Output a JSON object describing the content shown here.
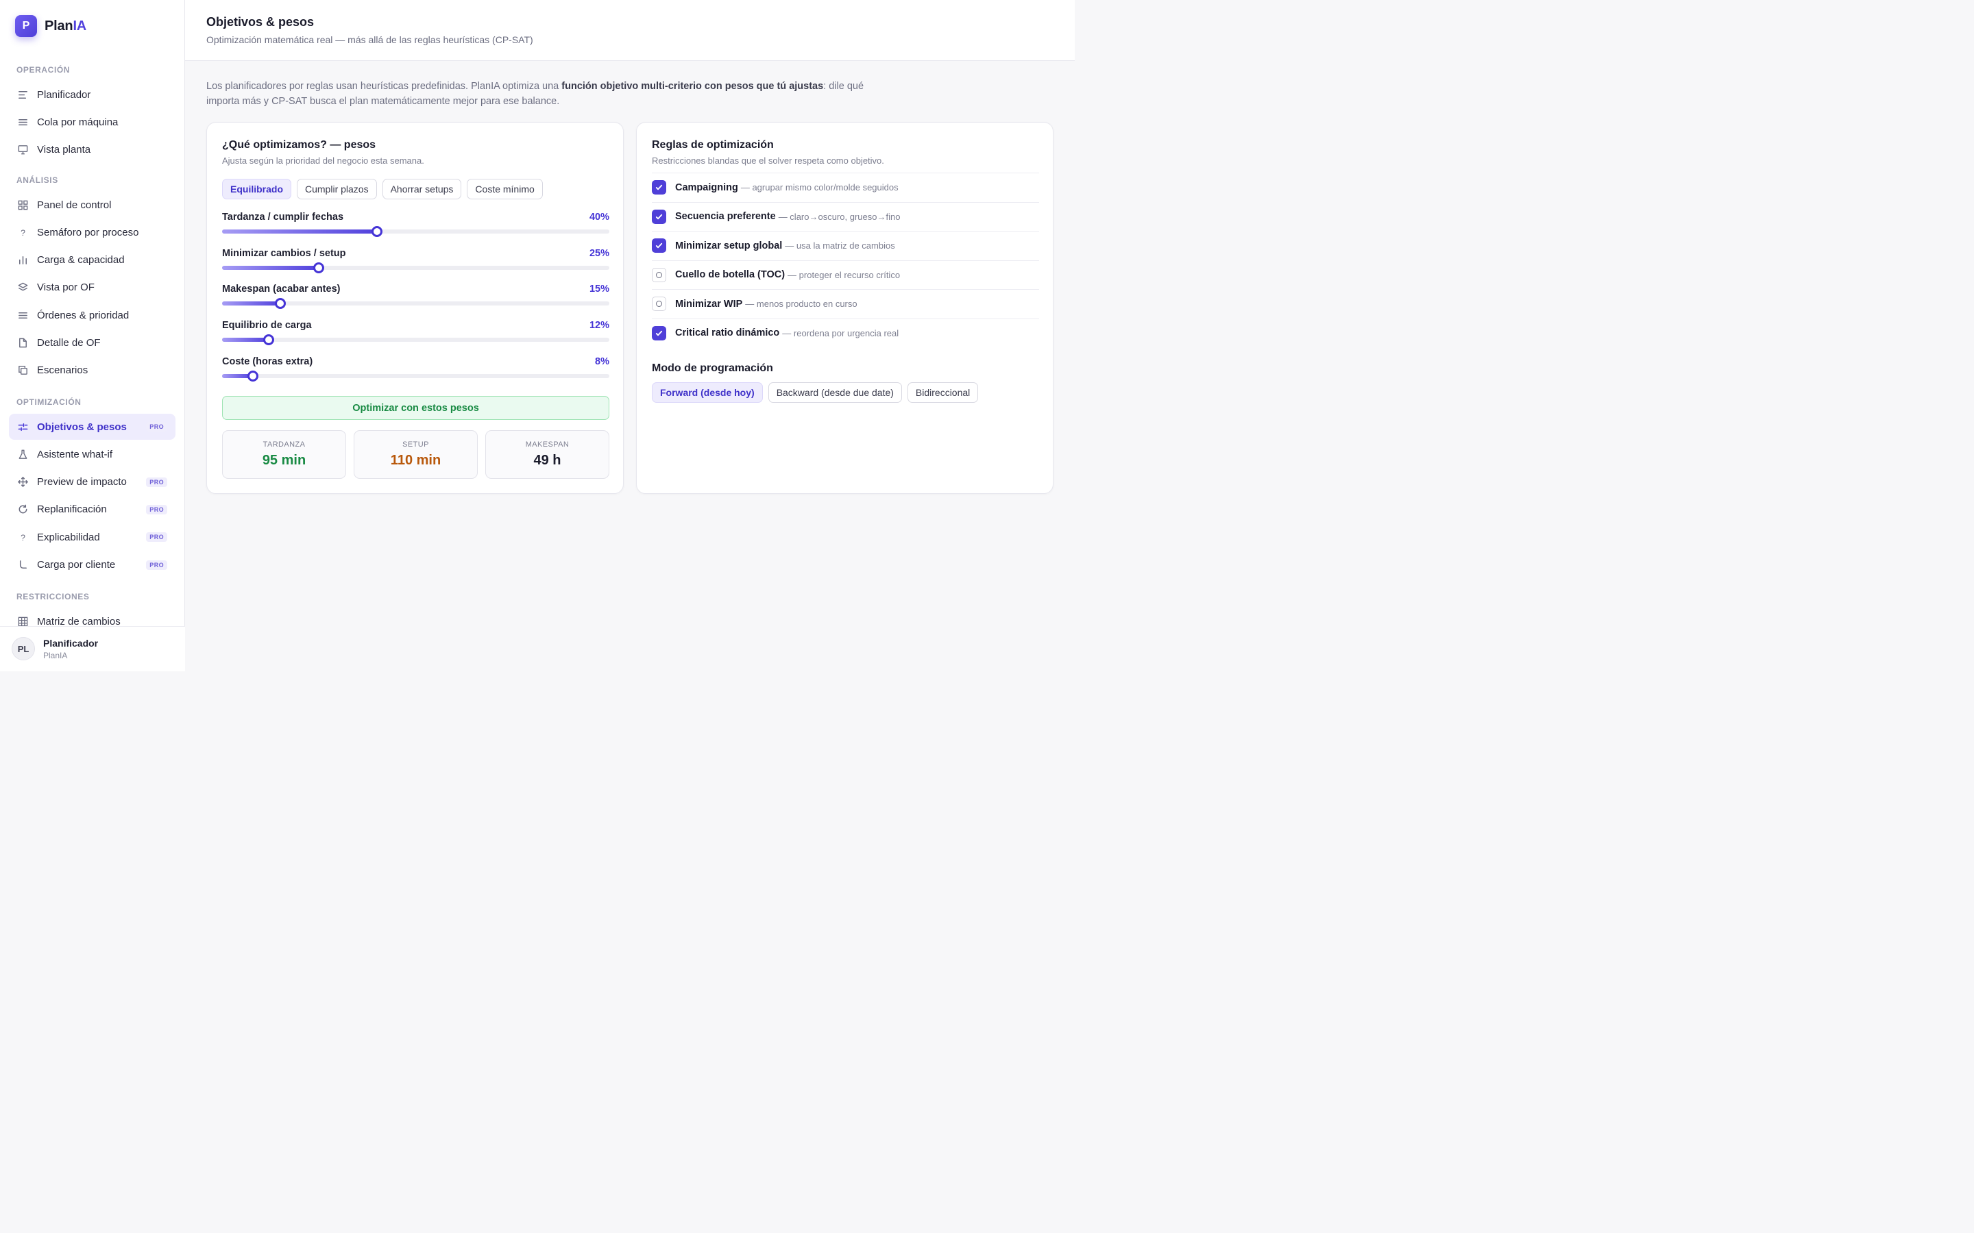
{
  "app": {
    "logo_letter": "P",
    "name_plain": "Plan",
    "name_accent": "IA"
  },
  "sidebar": {
    "sections": [
      {
        "label": "OPERACIÓN",
        "items": [
          {
            "label": "Planificador",
            "icon": "align-left-icon"
          },
          {
            "label": "Cola por máquina",
            "icon": "list-icon"
          },
          {
            "label": "Vista planta",
            "icon": "monitor-icon"
          }
        ]
      },
      {
        "label": "ANÁLISIS",
        "items": [
          {
            "label": "Panel de control",
            "icon": "grid-icon"
          },
          {
            "label": "Semáforo por proceso",
            "icon": "question-icon"
          },
          {
            "label": "Carga & capacidad",
            "icon": "bar-chart-icon"
          },
          {
            "label": "Vista por OF",
            "icon": "layers-icon"
          },
          {
            "label": "Órdenes & prioridad",
            "icon": "list-icon"
          },
          {
            "label": "Detalle de OF",
            "icon": "file-icon"
          },
          {
            "label": "Escenarios",
            "icon": "copy-icon"
          }
        ]
      },
      {
        "label": "OPTIMIZACIÓN",
        "items": [
          {
            "label": "Objetivos & pesos",
            "icon": "sliders-icon",
            "badge": "PRO",
            "active": true
          },
          {
            "label": "Asistente what-if",
            "icon": "flask-icon"
          },
          {
            "label": "Preview de impacto",
            "icon": "move-icon",
            "badge": "PRO"
          },
          {
            "label": "Replanificación",
            "icon": "refresh-icon",
            "badge": "PRO"
          },
          {
            "label": "Explicabilidad",
            "icon": "question-icon",
            "badge": "PRO"
          },
          {
            "label": "Carga por cliente",
            "icon": "corner-icon",
            "badge": "PRO"
          }
        ]
      },
      {
        "label": "RESTRICCIONES",
        "items": [
          {
            "label": "Matriz de cambios",
            "icon": "table-icon"
          }
        ]
      }
    ]
  },
  "user": {
    "initials": "PL",
    "name": "Planificador",
    "org": "PlanIA"
  },
  "header": {
    "title": "Objetivos & pesos",
    "subtitle": "Optimización matemática real — más allá de las reglas heurísticas (CP-SAT)"
  },
  "intro": {
    "before": "Los planificadores por reglas usan heurísticas predefinidas. PlanIA optimiza una ",
    "bold": "función objetivo multi-criterio con pesos que tú ajustas",
    "after": ": dile qué importa más y CP-SAT busca el plan matemáticamente mejor para ese balance."
  },
  "weights_card": {
    "title": "¿Qué optimizamos? — pesos",
    "subtitle": "Ajusta según la prioridad del negocio esta semana.",
    "presets": [
      {
        "label": "Equilibrado",
        "active": true
      },
      {
        "label": "Cumplir plazos"
      },
      {
        "label": "Ahorrar setups"
      },
      {
        "label": "Coste mínimo"
      }
    ],
    "sliders": [
      {
        "label": "Tardanza / cumplir fechas",
        "value": 40,
        "display": "40%"
      },
      {
        "label": "Minimizar cambios / setup",
        "value": 25,
        "display": "25%"
      },
      {
        "label": "Makespan (acabar antes)",
        "value": 15,
        "display": "15%"
      },
      {
        "label": "Equilibrio de carga",
        "value": 12,
        "display": "12%"
      },
      {
        "label": "Coste (horas extra)",
        "value": 8,
        "display": "8%"
      }
    ],
    "slider_max": 100,
    "optimize_label": "Optimizar con estos pesos",
    "stats": [
      {
        "label": "TARDANZA",
        "value": "95 min",
        "color": "#188a43"
      },
      {
        "label": "SETUP",
        "value": "110 min",
        "color": "#b8580b"
      },
      {
        "label": "MAKESPAN",
        "value": "49 h",
        "color": "#1a1b2b"
      }
    ]
  },
  "rules_card": {
    "title": "Reglas de optimización",
    "subtitle": "Restricciones blandas que el solver respeta como objetivo.",
    "rules": [
      {
        "name": "Campaigning",
        "desc": "— agrupar mismo color/molde seguidos",
        "checked": true
      },
      {
        "name": "Secuencia preferente",
        "desc": "— claro→oscuro, grueso→fino",
        "checked": true
      },
      {
        "name": "Minimizar setup global",
        "desc": "— usa la matriz de cambios",
        "checked": true
      },
      {
        "name": "Cuello de botella (TOC)",
        "desc": "— proteger el recurso crítico",
        "checked": false
      },
      {
        "name": "Minimizar WIP",
        "desc": "— menos producto en curso",
        "checked": false
      },
      {
        "name": "Critical ratio dinámico",
        "desc": "— reordena por urgencia real",
        "checked": true
      }
    ],
    "mode_title": "Modo de programación",
    "modes": [
      {
        "label": "Forward (desde hoy)",
        "active": true
      },
      {
        "label": "Backward (desde due date)"
      },
      {
        "label": "Bidireccional"
      }
    ]
  }
}
